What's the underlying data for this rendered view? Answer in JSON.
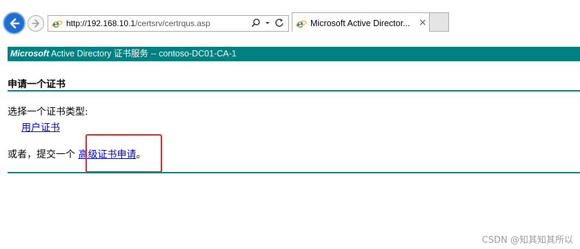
{
  "browser": {
    "address_url_host": "http://192.168.10.1",
    "address_url_path": "/certsrv/certrqus.asp",
    "search_icon": "search-icon",
    "tab_title": "Microsoft Active Director...",
    "tab_close": "×"
  },
  "page": {
    "banner_brand": "Microsoft",
    "banner_text": " Active Directory 证书服务  --  contoso-DC01-CA-1",
    "heading": "申请一个证书",
    "choose_label": "选择一个证书类型:",
    "user_cert_link": "用户证书",
    "or_text": "或者，提交一个 ",
    "advanced_link": "高级证书申请",
    "or_suffix": "。"
  },
  "watermark": "CSDN @知其知其所以",
  "colors": {
    "banner_bg": "#008080",
    "link": "#0000cc",
    "highlight": "#e02020"
  }
}
